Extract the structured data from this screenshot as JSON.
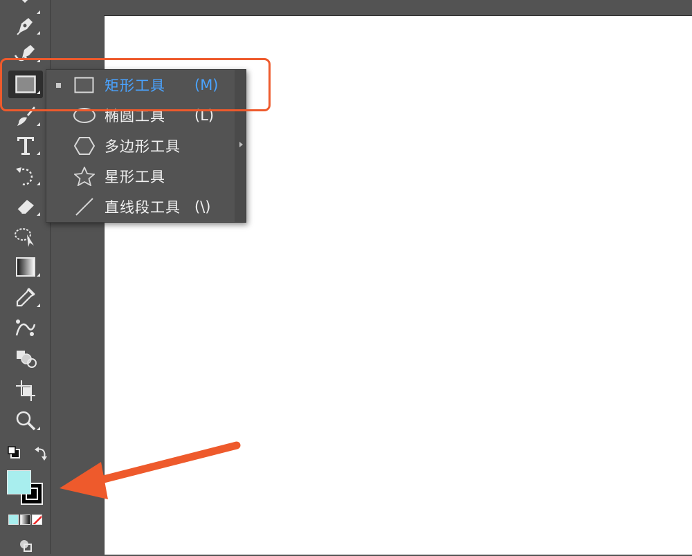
{
  "toolbar": {
    "tools": [
      {
        "name": "pen-tool",
        "icon": "pen-icon"
      },
      {
        "name": "curvature-tool",
        "icon": "curvature-pen-icon"
      },
      {
        "name": "rectangle-tool",
        "icon": "rectangle-icon",
        "active": true
      },
      {
        "name": "paintbrush-tool",
        "icon": "brush-icon"
      },
      {
        "name": "type-tool",
        "icon": "type-icon"
      },
      {
        "name": "rotate-tool",
        "icon": "rotate-icon"
      },
      {
        "name": "eraser-tool",
        "icon": "eraser-icon"
      },
      {
        "name": "lasso-select-tool",
        "icon": "lasso-icon"
      },
      {
        "name": "gradient-tool",
        "icon": "gradient-icon"
      },
      {
        "name": "eyedropper-tool",
        "icon": "eyedropper-icon"
      },
      {
        "name": "blend-tool",
        "icon": "blend-icon"
      },
      {
        "name": "shape-builder-tool",
        "icon": "shape-builder-icon"
      },
      {
        "name": "artboard-tool",
        "icon": "artboard-icon"
      },
      {
        "name": "zoom-tool",
        "icon": "magnifier-icon"
      }
    ],
    "colors": {
      "fill": "#a8eeee",
      "stroke": "#000000"
    }
  },
  "flyout": {
    "items": [
      {
        "label": "矩形工具",
        "shortcut": "(M)",
        "icon": "rectangle-icon",
        "selected": true
      },
      {
        "label": "椭圆工具",
        "shortcut": "(L)",
        "icon": "ellipse-icon"
      },
      {
        "label": "多边形工具",
        "shortcut": "",
        "icon": "polygon-icon"
      },
      {
        "label": "星形工具",
        "shortcut": "",
        "icon": "star-icon"
      },
      {
        "label": "直线段工具",
        "shortcut": "(\\)",
        "icon": "line-segment-icon"
      }
    ]
  },
  "annotations": {
    "highlight_color": "#ee5a2c",
    "arrow_color": "#ee5a2c"
  },
  "colors": {
    "ui_bg": "#535353",
    "selected_text": "#4aa3ff",
    "canvas": "#ffffff"
  }
}
